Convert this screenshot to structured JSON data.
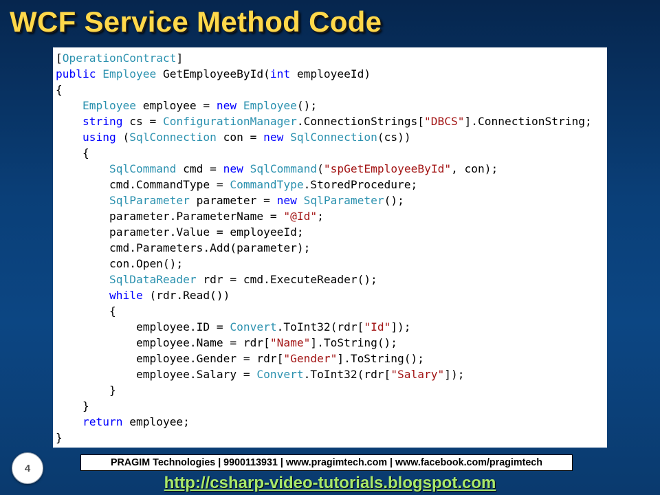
{
  "slide": {
    "title": "WCF Service Method Code",
    "slide_number": "4",
    "footer": "PRAGIM Technologies | 9900113931 | www.pragimtech.com | www.facebook.com/pragimtech",
    "link": "http://csharp-video-tutorials.blogspot.com"
  },
  "code": {
    "colors": {
      "keyword": "#0000ff",
      "type": "#2b91af",
      "string": "#a31515",
      "text": "#000000"
    },
    "lines": [
      [
        [
          "tx",
          "["
        ],
        [
          "ty",
          "OperationContract"
        ],
        [
          "tx",
          "]"
        ]
      ],
      [
        [
          "kw",
          "public"
        ],
        [
          "tx",
          " "
        ],
        [
          "ty",
          "Employee"
        ],
        [
          "tx",
          " GetEmployeeById("
        ],
        [
          "kw",
          "int"
        ],
        [
          "tx",
          " employeeId)"
        ]
      ],
      [
        [
          "tx",
          "{"
        ]
      ],
      [
        [
          "tx",
          "    "
        ],
        [
          "ty",
          "Employee"
        ],
        [
          "tx",
          " employee = "
        ],
        [
          "kw",
          "new"
        ],
        [
          "tx",
          " "
        ],
        [
          "ty",
          "Employee"
        ],
        [
          "tx",
          "();"
        ]
      ],
      [
        [
          "tx",
          "    "
        ],
        [
          "kw",
          "string"
        ],
        [
          "tx",
          " cs = "
        ],
        [
          "ty",
          "ConfigurationManager"
        ],
        [
          "tx",
          ".ConnectionStrings["
        ],
        [
          "st",
          "\"DBCS\""
        ],
        [
          "tx",
          "].ConnectionString;"
        ]
      ],
      [
        [
          "tx",
          "    "
        ],
        [
          "kw",
          "using"
        ],
        [
          "tx",
          " ("
        ],
        [
          "ty",
          "SqlConnection"
        ],
        [
          "tx",
          " con = "
        ],
        [
          "kw",
          "new"
        ],
        [
          "tx",
          " "
        ],
        [
          "ty",
          "SqlConnection"
        ],
        [
          "tx",
          "(cs))"
        ]
      ],
      [
        [
          "tx",
          "    {"
        ]
      ],
      [
        [
          "tx",
          "        "
        ],
        [
          "ty",
          "SqlCommand"
        ],
        [
          "tx",
          " cmd = "
        ],
        [
          "kw",
          "new"
        ],
        [
          "tx",
          " "
        ],
        [
          "ty",
          "SqlCommand"
        ],
        [
          "tx",
          "("
        ],
        [
          "st",
          "\"spGetEmployeeById\""
        ],
        [
          "tx",
          ", con);"
        ]
      ],
      [
        [
          "tx",
          "        cmd.CommandType = "
        ],
        [
          "ty",
          "CommandType"
        ],
        [
          "tx",
          ".StoredProcedure;"
        ]
      ],
      [
        [
          "tx",
          "        "
        ],
        [
          "ty",
          "SqlParameter"
        ],
        [
          "tx",
          " parameter = "
        ],
        [
          "kw",
          "new"
        ],
        [
          "tx",
          " "
        ],
        [
          "ty",
          "SqlParameter"
        ],
        [
          "tx",
          "();"
        ]
      ],
      [
        [
          "tx",
          "        parameter.ParameterName = "
        ],
        [
          "st",
          "\"@Id\""
        ],
        [
          "tx",
          ";"
        ]
      ],
      [
        [
          "tx",
          "        parameter.Value = employeeId;"
        ]
      ],
      [
        [
          "tx",
          "        cmd.Parameters.Add(parameter);"
        ]
      ],
      [
        [
          "tx",
          "        con.Open();"
        ]
      ],
      [
        [
          "tx",
          "        "
        ],
        [
          "ty",
          "SqlDataReader"
        ],
        [
          "tx",
          " rdr = cmd.ExecuteReader();"
        ]
      ],
      [
        [
          "tx",
          "        "
        ],
        [
          "kw",
          "while"
        ],
        [
          "tx",
          " (rdr.Read())"
        ]
      ],
      [
        [
          "tx",
          "        {"
        ]
      ],
      [
        [
          "tx",
          "            employee.ID = "
        ],
        [
          "ty",
          "Convert"
        ],
        [
          "tx",
          ".ToInt32(rdr["
        ],
        [
          "st",
          "\"Id\""
        ],
        [
          "tx",
          "]);"
        ]
      ],
      [
        [
          "tx",
          "            employee.Name = rdr["
        ],
        [
          "st",
          "\"Name\""
        ],
        [
          "tx",
          "].ToString();"
        ]
      ],
      [
        [
          "tx",
          "            employee.Gender = rdr["
        ],
        [
          "st",
          "\"Gender\""
        ],
        [
          "tx",
          "].ToString();"
        ]
      ],
      [
        [
          "tx",
          "            employee.Salary = "
        ],
        [
          "ty",
          "Convert"
        ],
        [
          "tx",
          ".ToInt32(rdr["
        ],
        [
          "st",
          "\"Salary\""
        ],
        [
          "tx",
          "]);"
        ]
      ],
      [
        [
          "tx",
          "        }"
        ]
      ],
      [
        [
          "tx",
          "    }"
        ]
      ],
      [
        [
          "tx",
          "    "
        ],
        [
          "kw",
          "return"
        ],
        [
          "tx",
          " employee;"
        ]
      ],
      [
        [
          "tx",
          "}"
        ]
      ]
    ]
  }
}
